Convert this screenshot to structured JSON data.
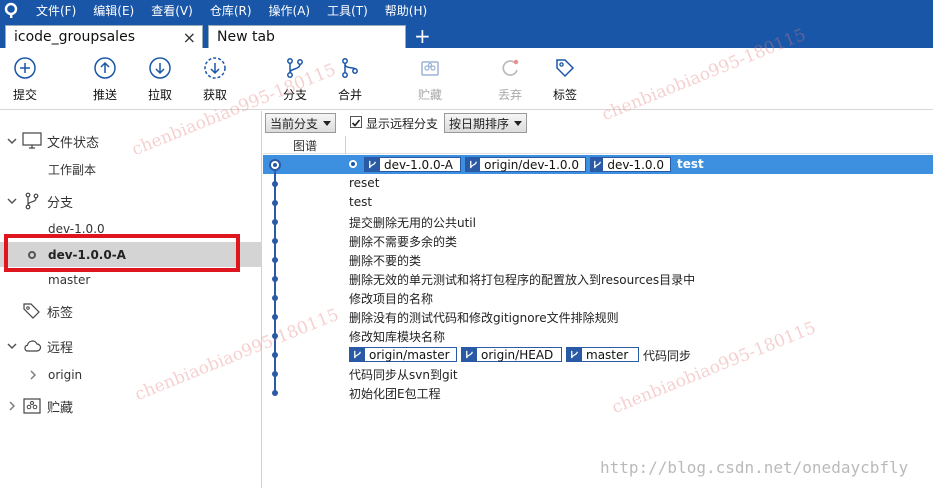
{
  "menu": [
    "文件(F)",
    "编辑(E)",
    "查看(V)",
    "仓库(R)",
    "操作(A)",
    "工具(T)",
    "帮助(H)"
  ],
  "tabs": [
    {
      "label": "icode_groupsales",
      "close": "×"
    },
    {
      "label": "New tab"
    }
  ],
  "tab_add": "+",
  "toolbar": {
    "commit": "提交",
    "push": "推送",
    "pull": "拉取",
    "fetch": "获取",
    "branch": "分支",
    "merge": "合并",
    "stash": "贮藏",
    "discard": "丢弃",
    "tag": "标签"
  },
  "sidebar": {
    "file_status": "文件状态",
    "working_copy": "工作副本",
    "branches": "分支",
    "branch_items": [
      "dev-1.0.0",
      "dev-1.0.0-A",
      "master"
    ],
    "tags": "标签",
    "remotes": "远程",
    "remote_items": [
      "origin"
    ],
    "stashes": "贮藏"
  },
  "filter": {
    "branch_filter": "当前分支",
    "show_remote": "显示远程分支",
    "sort": "按日期排序"
  },
  "columns": {
    "graph": "图谱"
  },
  "commits": [
    {
      "refs": [
        "dev-1.0.0-A",
        "origin/dev-1.0.0",
        "dev-1.0.0"
      ],
      "message": "test",
      "selected": true,
      "head": true
    },
    {
      "refs": [],
      "message": "reset"
    },
    {
      "refs": [],
      "message": "test"
    },
    {
      "refs": [],
      "message": "提交删除无用的公共util"
    },
    {
      "refs": [],
      "message": "删除不需要多余的类"
    },
    {
      "refs": [],
      "message": "删除不要的类"
    },
    {
      "refs": [],
      "message": "删除无效的单元测试和将打包程序的配置放入到resources目录中"
    },
    {
      "refs": [],
      "message": "修改项目的名称"
    },
    {
      "refs": [],
      "message": "删除没有的测试代码和修改gitignore文件排除规则"
    },
    {
      "refs": [],
      "message": "修改知库模块名称"
    },
    {
      "refs": [
        "origin/master",
        "origin/HEAD",
        "master"
      ],
      "message": "代码同步"
    },
    {
      "refs": [],
      "message": "代码同步从svn到git"
    },
    {
      "refs": [],
      "message": "初始化团E包工程"
    }
  ],
  "watermark": "chenbiaobiao995-180115",
  "url_watermark": "http://blog.csdn.net/onedaycbfly",
  "colors": {
    "menu_bg": "#1a56a8",
    "selection": "#3d8fe0",
    "graph": "#2a5aa6",
    "highlight": "#e0161f"
  }
}
